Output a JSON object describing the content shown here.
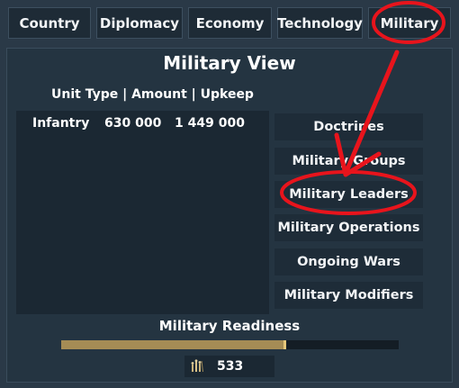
{
  "tabs": {
    "country": "Country",
    "diplomacy": "Diplomacy",
    "economy": "Economy",
    "technology": "Technology",
    "military": "Military"
  },
  "panel": {
    "title": "Military View",
    "columns": "Unit Type | Amount | Upkeep"
  },
  "units": [
    {
      "type": "Infantry",
      "amount": "630 000",
      "upkeep": "1 449 000"
    }
  ],
  "side_buttons": {
    "doctrines": "Doctrines",
    "groups": "Military Groups",
    "leaders": "Military Leaders",
    "operations": "Military Operations",
    "wars": "Ongoing Wars",
    "modifiers": "Military Modifiers"
  },
  "readiness": {
    "label": "Military Readiness",
    "fraction": 0.66
  },
  "counter": {
    "icon": "soldiers-icon",
    "value": "533"
  },
  "annotation": {
    "color": "#e8141c"
  }
}
